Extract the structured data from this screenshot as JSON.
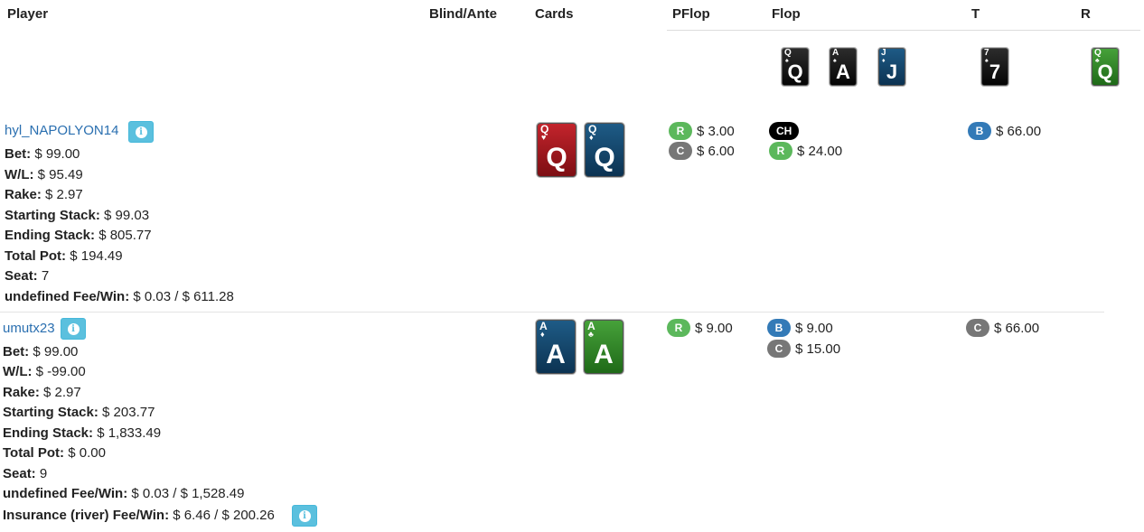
{
  "columns": {
    "player": "Player",
    "blind_ante": "Blind/Ante",
    "cards": "Cards",
    "preflop": "PFlop",
    "flop": "Flop",
    "turn": "T",
    "river": "R"
  },
  "board": {
    "flop": [
      {
        "rank": "Q",
        "suit": "♠",
        "color": "black"
      },
      {
        "rank": "A",
        "suit": "♠",
        "color": "black"
      },
      {
        "rank": "J",
        "suit": "♦",
        "color": "blue"
      }
    ],
    "turn": {
      "rank": "7",
      "suit": "♠",
      "color": "black"
    },
    "river": {
      "rank": "Q",
      "suit": "♣",
      "color": "green"
    }
  },
  "players": [
    {
      "name": "hyl_NAPOLYON14",
      "info_icon": "info-icon",
      "cards": [
        {
          "rank": "Q",
          "suit": "♥",
          "color": "red"
        },
        {
          "rank": "Q",
          "suit": "♦",
          "color": "blue"
        }
      ],
      "stats": [
        {
          "label": "Bet:",
          "value": "$ 99.00"
        },
        {
          "label": "W/L:",
          "value": "$ 95.49"
        },
        {
          "label": "Rake:",
          "value": "$ 2.97"
        },
        {
          "label": "Starting Stack:",
          "value": "$ 99.03"
        },
        {
          "label": "Ending Stack:",
          "value": "$ 805.77"
        },
        {
          "label": "Total Pot:",
          "value": "$ 194.49"
        },
        {
          "label": "Seat:",
          "value": "7"
        },
        {
          "label": "undefined Fee/Win:",
          "value": "$ 0.03 / $ 611.28"
        }
      ],
      "preflop": [
        {
          "badge": "R",
          "amount": "$ 3.00"
        },
        {
          "badge": "C",
          "amount": "$ 6.00"
        }
      ],
      "flop": [
        {
          "badge": "CH",
          "amount": ""
        },
        {
          "badge": "R",
          "amount": "$ 24.00"
        }
      ],
      "turn": [
        {
          "badge": "B",
          "amount": "$ 66.00"
        }
      ]
    },
    {
      "name": "umutx23",
      "info_icon": "info-icon",
      "cards": [
        {
          "rank": "A",
          "suit": "♦",
          "color": "blue"
        },
        {
          "rank": "A",
          "suit": "♣",
          "color": "green"
        }
      ],
      "stats": [
        {
          "label": "Bet:",
          "value": "$ 99.00"
        },
        {
          "label": "W/L:",
          "value": "$ -99.00"
        },
        {
          "label": "Rake:",
          "value": "$ 2.97"
        },
        {
          "label": "Starting Stack:",
          "value": "$ 203.77"
        },
        {
          "label": "Ending Stack:",
          "value": "$ 1,833.49"
        },
        {
          "label": "Total Pot:",
          "value": "$ 0.00"
        },
        {
          "label": "Seat:",
          "value": "9"
        },
        {
          "label": "undefined Fee/Win:",
          "value": "$ 0.03 / $ 1,528.49"
        },
        {
          "label": "Insurance (river) Fee/Win:",
          "value": "$ 6.46 / $ 200.26"
        }
      ],
      "preflop": [
        {
          "badge": "R",
          "amount": "$ 9.00"
        }
      ],
      "flop": [
        {
          "badge": "B",
          "amount": "$ 9.00"
        },
        {
          "badge": "C",
          "amount": "$ 15.00"
        }
      ],
      "turn": [
        {
          "badge": "C",
          "amount": "$ 66.00"
        }
      ]
    }
  ]
}
